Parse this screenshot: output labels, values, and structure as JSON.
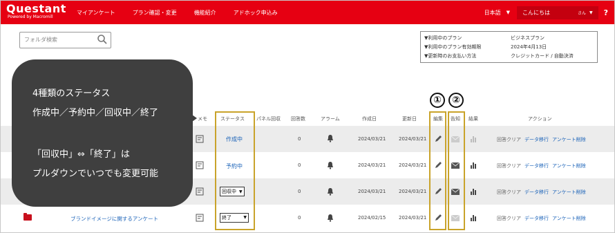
{
  "header": {
    "logo": "Questant",
    "logo_sub": "Powered by Macromill",
    "nav": [
      "マイアンケート",
      "プラン確認・変更",
      "機能紹介",
      "アドホック申込み"
    ],
    "language": "日本語",
    "greeting": "こんにちは",
    "user_suffix": "さん",
    "help": "?"
  },
  "search": {
    "placeholder": "フォルダ検索"
  },
  "plan": {
    "rows": [
      {
        "label": "▼利用中のプラン",
        "value": "ビジネスプラン"
      },
      {
        "label": "▼利用中のプラン有効期限",
        "value": "2024年4月13日"
      },
      {
        "label": "▼更新時のお支払い方法",
        "value": "クレジットカード / 自動決済"
      }
    ]
  },
  "table": {
    "headers": {
      "memo": "メモ",
      "status": "ステータス",
      "panel": "パネル回収",
      "responses": "回答数",
      "alarm": "アラーム",
      "created": "作成日",
      "updated": "更新日",
      "edit": "編集",
      "notify": "告知",
      "result": "結果",
      "action": "アクション"
    },
    "rows": [
      {
        "title": "",
        "status": "作成中",
        "responses": "0",
        "created": "2024/03/21",
        "updated": "2024/03/21"
      },
      {
        "title": "",
        "status": "予約中",
        "responses": "0",
        "created": "2024/03/21",
        "updated": "2024/03/21"
      },
      {
        "title": "",
        "status": "回収中",
        "responses": "0",
        "created": "2024/03/21",
        "updated": "2024/03/21"
      },
      {
        "title": "ブランドイメージに関するアンケート",
        "status": "終了",
        "responses": "0",
        "created": "2024/02/15",
        "updated": "2024/03/21"
      }
    ],
    "actions": {
      "clear": "回答クリア",
      "move": "データ移行",
      "delete": "アンケート削除"
    }
  },
  "annotations": {
    "num1": "①",
    "num2": "②",
    "callout": {
      "line1": "4種類のステータス",
      "line2": "作成中／予約中／回収中／終了",
      "line3": "「回収中」⇔「終了」は",
      "line4": "プルダウンでいつでも変更可能"
    }
  },
  "colors": {
    "brand_red": "#e60012",
    "highlight": "#c9a32a",
    "link": "#1a62b8",
    "callout": "#3f3f3f"
  }
}
